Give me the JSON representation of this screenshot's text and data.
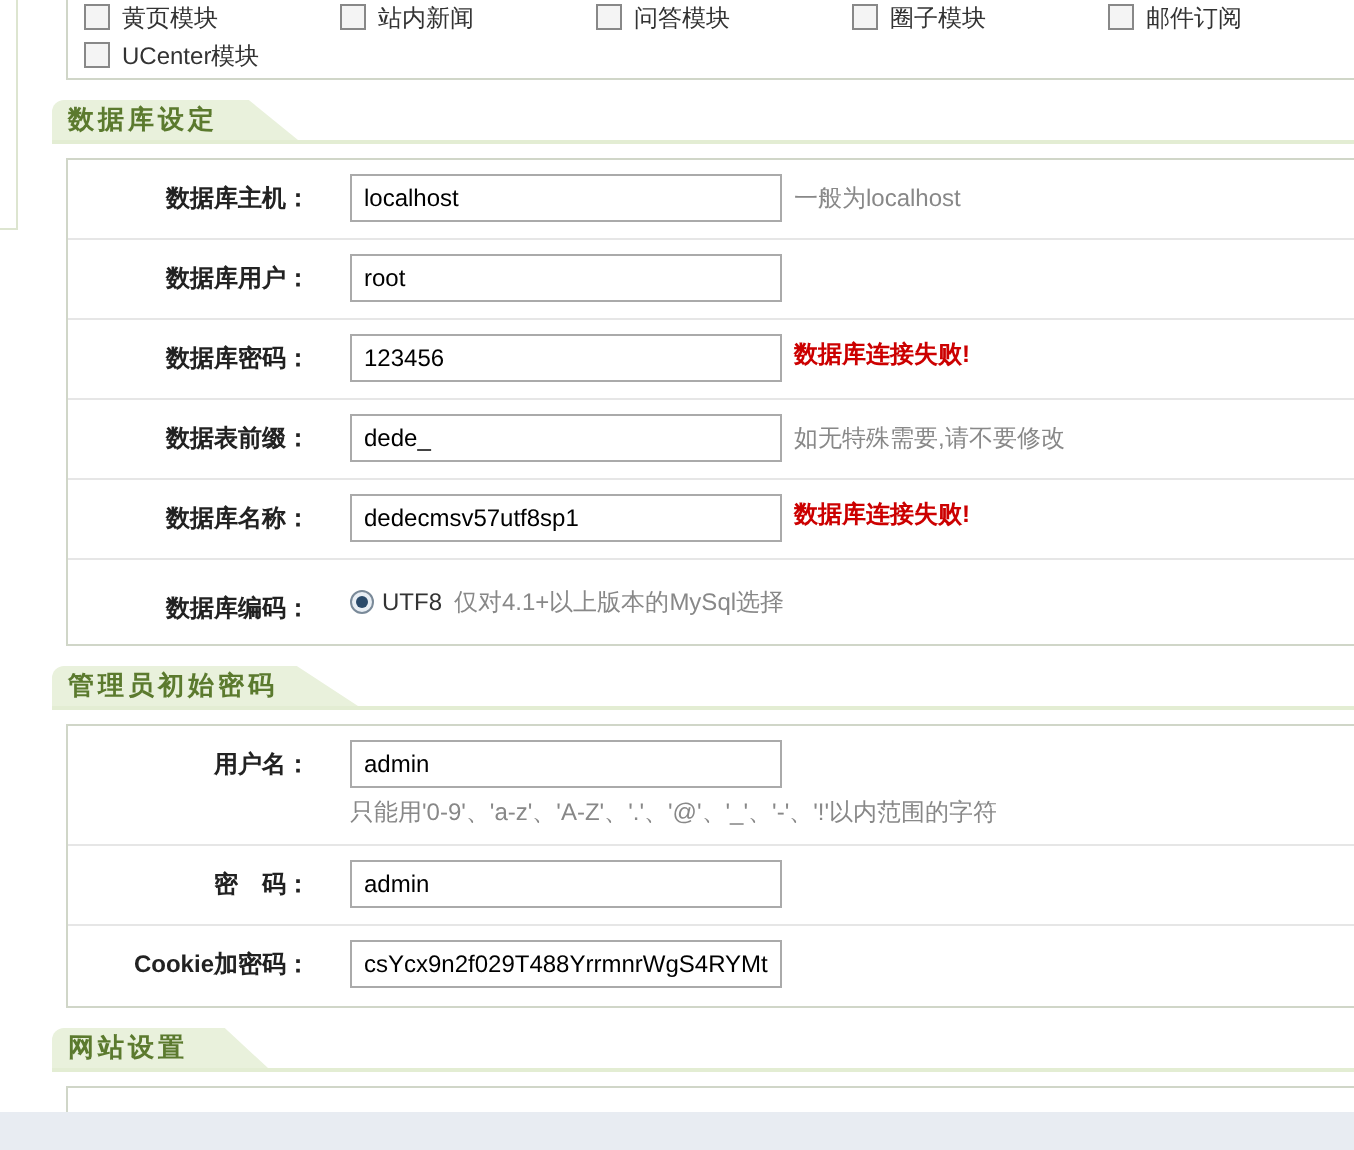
{
  "modules": [
    {
      "label": "黄页模块",
      "checked": false
    },
    {
      "label": "站内新闻",
      "checked": false
    },
    {
      "label": "问答模块",
      "checked": false
    },
    {
      "label": "圈子模块",
      "checked": false
    },
    {
      "label": "邮件订阅",
      "checked": false
    },
    {
      "label": "UCenter模块",
      "checked": false
    }
  ],
  "sections": [
    {
      "title": "数据库设定",
      "rows": [
        {
          "kind": "input",
          "label": "数据库主机：",
          "value": "localhost",
          "note": "一般为localhost",
          "error": false
        },
        {
          "kind": "input",
          "label": "数据库用户：",
          "value": "root"
        },
        {
          "kind": "input",
          "label": "数据库密码：",
          "value": "123456",
          "note": "数据库连接失败!",
          "error": true
        },
        {
          "kind": "input",
          "label": "数据表前缀：",
          "value": "dede_",
          "note": "如无特殊需要,请不要修改",
          "error": false
        },
        {
          "kind": "input",
          "label": "数据库名称：",
          "value": "dedecmsv57utf8sp1",
          "note": "数据库连接失败!",
          "error": true
        },
        {
          "kind": "radio",
          "label": "数据库编码：",
          "option": "UTF8",
          "selected": true,
          "note": "仅对4.1+以上版本的MySql选择",
          "error": false
        }
      ]
    },
    {
      "title": "管理员初始密码",
      "rows": [
        {
          "kind": "input",
          "label": "用户名：",
          "value": "admin",
          "hint": "只能用'0-9'、'a-z'、'A-Z'、'.'、'@'、'_'、'-'、'!'以内范围的字符"
        },
        {
          "kind": "input",
          "label": "密　码：",
          "value": "admin"
        },
        {
          "kind": "input",
          "label": "Cookie加密码：",
          "value": "csYcx9n2f029T488YrrmnrWgS4RYMt"
        }
      ]
    },
    {
      "title": "网站设置"
    }
  ]
}
